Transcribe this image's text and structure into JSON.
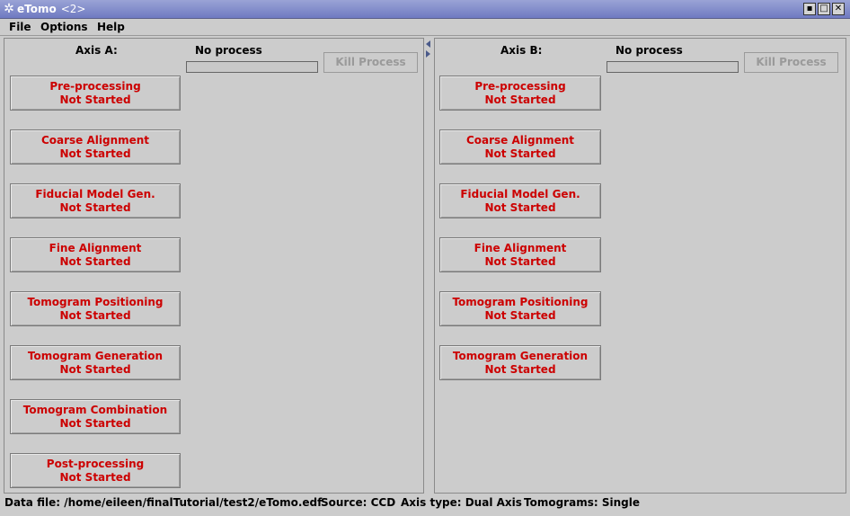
{
  "window": {
    "title": "eTomo",
    "title_suffix": "<2>",
    "controls": [
      "minimize-icon",
      "maximize-icon",
      "close-icon"
    ],
    "accent_color": "#6f7ac2"
  },
  "menubar": {
    "items": [
      {
        "label": "File"
      },
      {
        "label": "Options"
      },
      {
        "label": "Help"
      }
    ]
  },
  "axis_a": {
    "label": "Axis A:",
    "process_status": "No process",
    "progress": 0,
    "kill_button": "Kill Process",
    "steps": [
      {
        "name": "Pre-processing",
        "status": "Not Started"
      },
      {
        "name": "Coarse Alignment",
        "status": "Not Started"
      },
      {
        "name": "Fiducial Model Gen.",
        "status": "Not Started"
      },
      {
        "name": "Fine Alignment",
        "status": "Not Started"
      },
      {
        "name": "Tomogram Positioning",
        "status": "Not Started"
      },
      {
        "name": "Tomogram Generation",
        "status": "Not Started"
      },
      {
        "name": "Tomogram Combination",
        "status": "Not Started"
      },
      {
        "name": "Post-processing",
        "status": "Not Started"
      }
    ]
  },
  "axis_b": {
    "label": "Axis B:",
    "process_status": "No process",
    "progress": 0,
    "kill_button": "Kill Process",
    "steps": [
      {
        "name": "Pre-processing",
        "status": "Not Started"
      },
      {
        "name": "Coarse Alignment",
        "status": "Not Started"
      },
      {
        "name": "Fiducial Model Gen.",
        "status": "Not Started"
      },
      {
        "name": "Fine Alignment",
        "status": "Not Started"
      },
      {
        "name": "Tomogram Positioning",
        "status": "Not Started"
      },
      {
        "name": "Tomogram Generation",
        "status": "Not Started"
      }
    ]
  },
  "status_bar": {
    "data_file": "Data file: /home/eileen/finalTutorial/test2/eTomo.edf",
    "source": "Source: CCD",
    "axis_type": "Axis type: Dual Axis",
    "tomograms": "Tomograms: Single"
  },
  "colors": {
    "step_text": "#cc0000",
    "disabled_text": "#9a9a9a",
    "background": "#cccccc"
  }
}
